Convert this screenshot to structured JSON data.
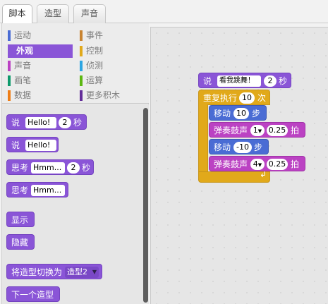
{
  "tabs": [
    "脚本",
    "造型",
    "声音"
  ],
  "categories": {
    "left": [
      "运动",
      "外观",
      "声音",
      "画笔",
      "数据"
    ],
    "right": [
      "事件",
      "控制",
      "侦测",
      "运算",
      "更多积木"
    ],
    "selected": "外观",
    "colors": {
      "运动": "#4a6cd4",
      "外观": "#8a55d7",
      "声音": "#bb42c3",
      "画笔": "#0e9a6c",
      "数据": "#ee7d16",
      "事件": "#c88330",
      "控制": "#e1a91a",
      "侦测": "#2ca5e2",
      "运算": "#5cb712",
      "更多积木": "#632d99"
    }
  },
  "palette_blocks": {
    "say_for": {
      "label": "说",
      "text": "Hello!",
      "secs": "2",
      "unit": "秒"
    },
    "say": {
      "label": "说",
      "text": "Hello!"
    },
    "think_for": {
      "label": "思考",
      "text": "Hmm...",
      "secs": "2",
      "unit": "秒"
    },
    "think": {
      "label": "思考",
      "text": "Hmm..."
    },
    "show": {
      "label": "显示"
    },
    "hide": {
      "label": "隐藏"
    },
    "switch_costume": {
      "label": "将造型切换为",
      "costume": "造型2"
    },
    "next_costume": {
      "label": "下一个造型"
    }
  },
  "script": {
    "say": {
      "label": "说",
      "text": "看我跳舞！",
      "secs": "2",
      "unit": "秒"
    },
    "repeat": {
      "label": "重复执行",
      "times": "10",
      "unit": "次"
    },
    "move1": {
      "label": "移动",
      "steps": "10",
      "unit": "步"
    },
    "drum1": {
      "label": "弹奏鼓声",
      "drum": "1",
      "beats": "0.25",
      "unit": "拍"
    },
    "move2": {
      "label": "移动",
      "steps": "-10",
      "unit": "步"
    },
    "drum2": {
      "label": "弹奏鼓声",
      "drum": "4",
      "beats": "0.25",
      "unit": "拍"
    },
    "loop_arrow": "↲"
  }
}
